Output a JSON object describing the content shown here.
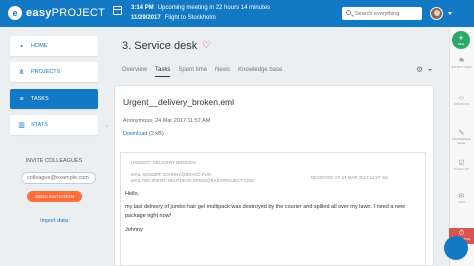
{
  "header": {
    "logo_mark": "e",
    "logo_text_bold": "easy",
    "logo_text_rest": "PROJECT",
    "event1_time": "3:14 PM",
    "event1_text": "Upcoming meeting in 22 hours 14 minutes",
    "event2_date": "11/29/2017",
    "event2_text": "Flight to Stockholm",
    "search_placeholder": "Search everything"
  },
  "sidebar": {
    "items": [
      {
        "label": "HOME",
        "icon": "home-icon",
        "glyph": "▪"
      },
      {
        "label": "PROJECTS",
        "icon": "sitemap-icon",
        "glyph": "⋔"
      },
      {
        "label": "TASKS",
        "icon": "list-icon",
        "glyph": "≡"
      },
      {
        "label": "STATS",
        "icon": "chart-icon",
        "glyph": "▥"
      }
    ],
    "invite_title": "INVITE COLLEAGUES",
    "invite_placeholder": "colleague@example.com",
    "send_label": "SEND INVITATION",
    "import_label": "Import data",
    "collapse_glyph": "‹"
  },
  "main": {
    "title": "3. Service desk",
    "heart_glyph": "♡",
    "tabs": [
      "Overview",
      "Tasks",
      "Spent time",
      "News",
      "Knowledge base"
    ],
    "active_tab": "Tasks",
    "gear_glyph": "⚙"
  },
  "attachment": {
    "filename": "Urgent__delivery_broken.eml",
    "meta": "Anonymous, 24 Mar 2017 11:57 AM",
    "download_label": "Download",
    "size": "(2 kB)"
  },
  "email": {
    "subject": "URGENT: DELIVERY BROKEN",
    "sender": "MAIL SENDER: JOHNNY@BRAVO.FUN",
    "recipient": "MAIL RECIPIENT: HELP.DESK.DEMO@EASYPROJECT.COM",
    "received": "RECEIVED AT: 24 MAR 2017 11:57 AM",
    "greeting": "Hello,",
    "message": "my last delivery of jumbo hair gel multipack was destroyed by the courier and spilled all over my lawn. I need a new package right now!",
    "signature": "Johnny"
  },
  "rail": {
    "new_plus": "+",
    "new_label": "NEW",
    "items": [
      {
        "label": "ACTIVITY FEED",
        "icon": "activity-feed-icon",
        "glyph": "⚑"
      },
      {
        "label": "CONTACTS",
        "icon": "contacts-icon",
        "glyph": "☺"
      },
      {
        "label": "KNOWLEDGE BASE",
        "icon": "knowledge-base-icon",
        "glyph": "✎"
      },
      {
        "label": "TO DO LIST",
        "icon": "todo-list-icon",
        "glyph": "☑"
      },
      {
        "label": "CHAT",
        "icon": "chat-icon",
        "glyph": "✉"
      },
      {
        "label": "STOPWATCH",
        "icon": "stopwatch-icon",
        "glyph": "⏱"
      }
    ]
  },
  "colors": {
    "brand_blue": "#1479c4",
    "invite_orange": "#ff6d3a",
    "new_green": "#2ea866",
    "heart_red": "#e8475a"
  }
}
